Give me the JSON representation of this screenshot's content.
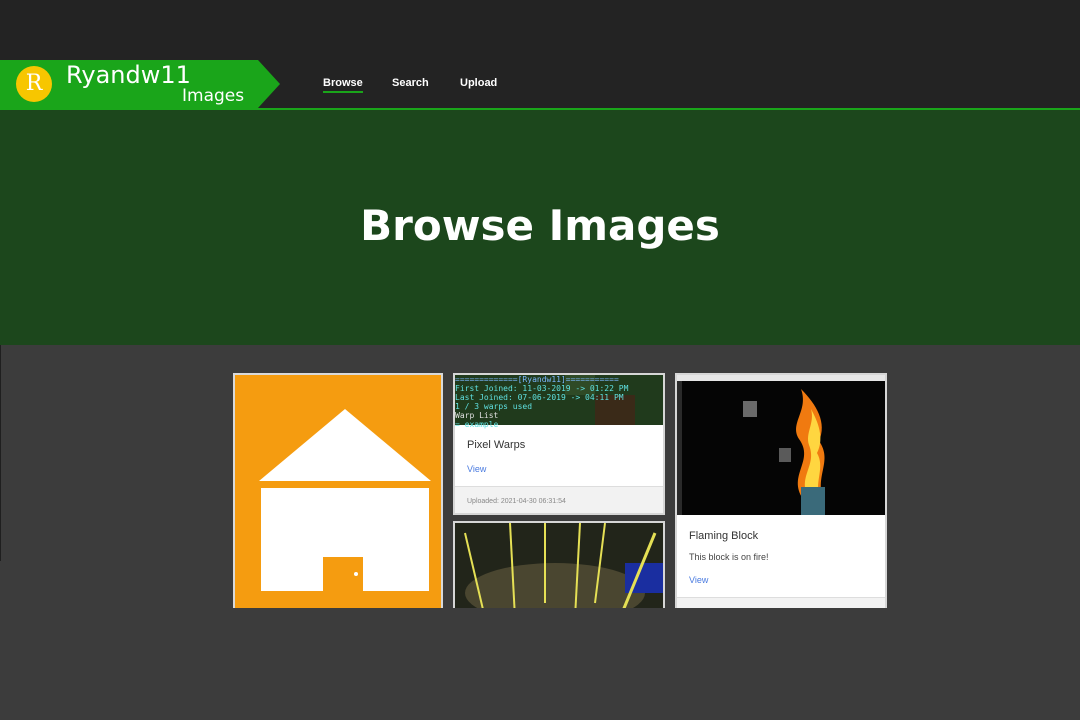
{
  "brand": {
    "logo_letter": "R",
    "title": "Ryandw11",
    "subtitle": "Images"
  },
  "nav": {
    "browse": "Browse",
    "search": "Search",
    "upload": "Upload"
  },
  "hero": {
    "title": "Browse Images"
  },
  "cards": {
    "pixel_warps": {
      "term_lines": [
        "=============[Ryandw11]===========",
        "First Joined: 11-03-2019 -> 01:22 PM",
        "Last Joined: 07-06-2019 -> 04:11 PM",
        "1 / 3 warps used",
        "Warp List",
        "= example"
      ],
      "title": "Pixel Warps",
      "link": "View",
      "uploaded": "Uploaded: 2021-04-30 06:31:54"
    },
    "flaming_block": {
      "title": "Flaming Block",
      "text": "This block is on fire!",
      "link": "View"
    }
  },
  "colors": {
    "accent": "#1aa51a",
    "hero": "#1c471c",
    "navbar": "#232323",
    "background": "#3c3c3c",
    "house_tile": "#f59c10",
    "link": "#4a7be0"
  }
}
